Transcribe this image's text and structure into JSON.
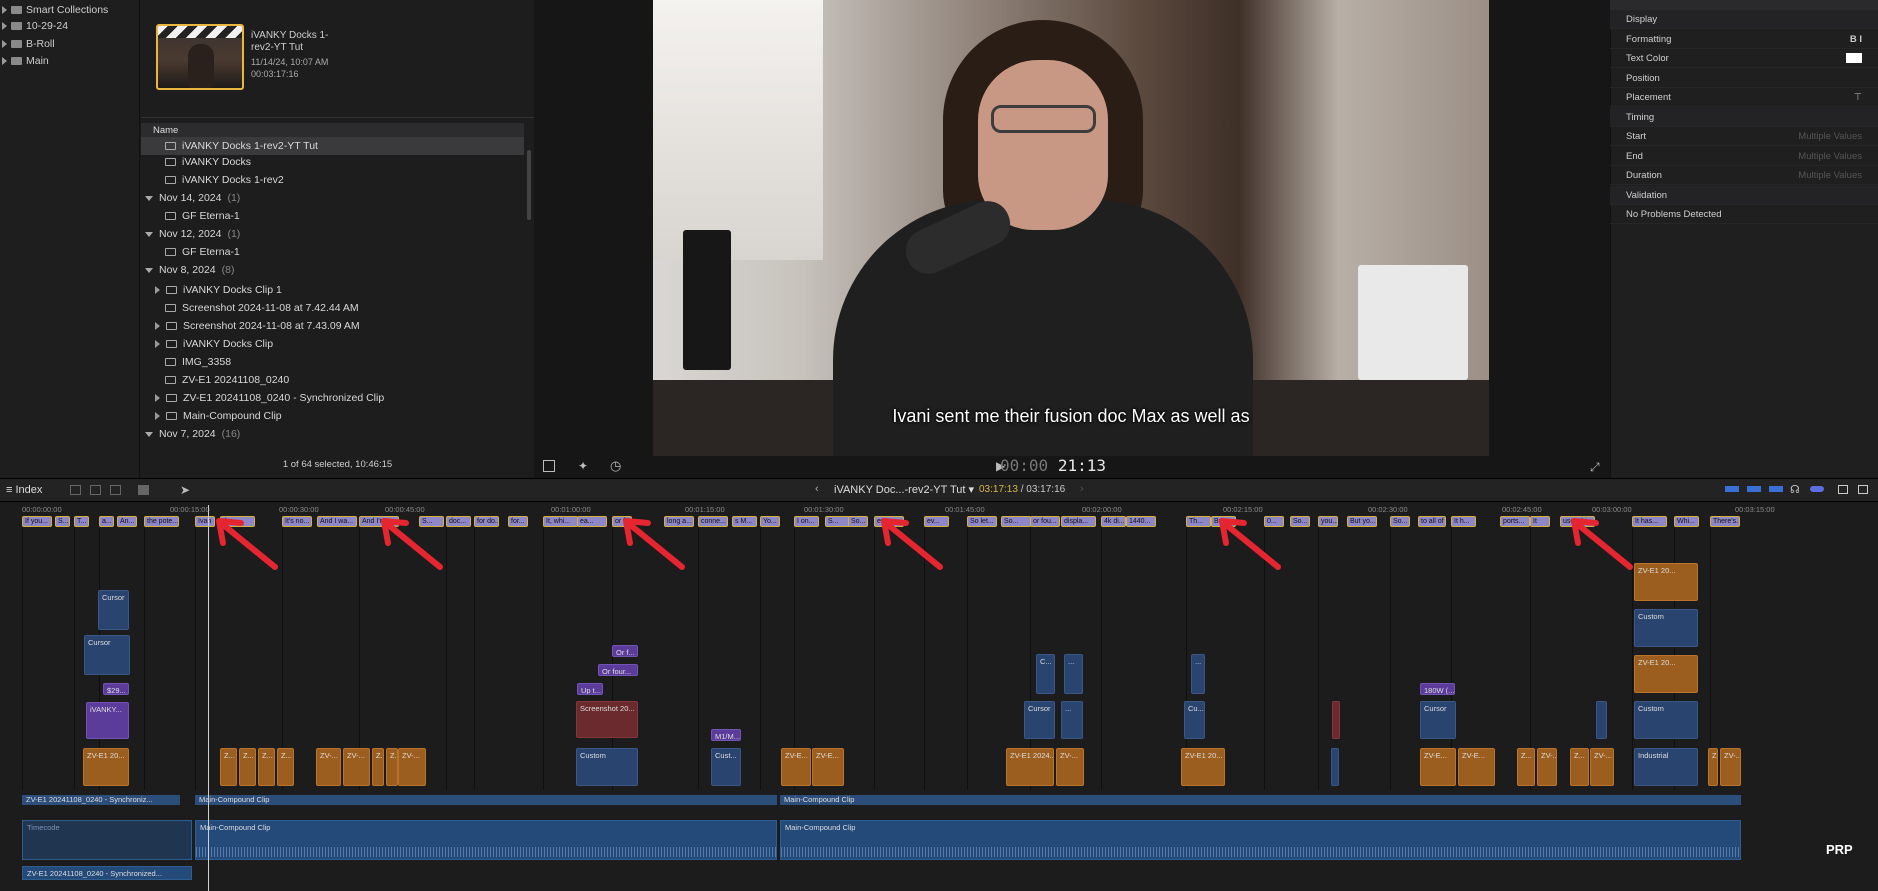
{
  "sidebar": {
    "items": [
      {
        "label": "Smart Collections"
      },
      {
        "label": "10-29-24"
      },
      {
        "label": "B-Roll"
      },
      {
        "label": "Main"
      }
    ]
  },
  "browser": {
    "clip": {
      "title_line1": "iVANKY Docks 1-",
      "title_line2": "rev2-YT Tut",
      "date": "11/14/24, 10:07 AM",
      "duration": "00:03:17:16"
    },
    "column_name": "Name",
    "rows": [
      {
        "label": "iVANKY Docks 1-rev2-YT Tut",
        "kind": "item"
      },
      {
        "label": "iVANKY Docks",
        "kind": "item"
      },
      {
        "label": "iVANKY Docks 1-rev2",
        "kind": "item"
      },
      {
        "label": "Nov 14, 2024",
        "count": "(1)",
        "kind": "group"
      },
      {
        "label": "GF Eterna-1",
        "kind": "item"
      },
      {
        "label": "Nov 12, 2024",
        "count": "(1)",
        "kind": "group"
      },
      {
        "label": "GF Eterna-1",
        "kind": "item"
      },
      {
        "label": "Nov 8, 2024",
        "count": "(8)",
        "kind": "group"
      },
      {
        "label": "iVANKY Docks Clip 1",
        "kind": "item"
      },
      {
        "label": "Screenshot 2024-11-08 at 7.42.44 AM",
        "kind": "item"
      },
      {
        "label": "Screenshot 2024-11-08 at 7.43.09 AM",
        "kind": "item"
      },
      {
        "label": "iVANKY Docks Clip",
        "kind": "item"
      },
      {
        "label": "IMG_3358",
        "kind": "item"
      },
      {
        "label": "ZV-E1 20241108_0240",
        "kind": "item"
      },
      {
        "label": "ZV-E1 20241108_0240 - Synchronized Clip",
        "kind": "item"
      },
      {
        "label": "Main-Compound Clip",
        "kind": "item"
      },
      {
        "label": "Nov 7, 2024",
        "count": "(16)",
        "kind": "group"
      }
    ],
    "status": "1 of 64 selected, 10:46:15"
  },
  "viewer": {
    "subtitle": "Ivani sent me their fusion doc Max as well as",
    "timecode_dim": "00:00",
    "timecode_bright": "21:13"
  },
  "inspector": {
    "rows": [
      {
        "label": "Display",
        "value": ""
      },
      {
        "label": "Formatting",
        "value": "B I"
      },
      {
        "label": "Text Color",
        "value": ""
      },
      {
        "label": "Position",
        "value": ""
      },
      {
        "label": "Placement",
        "value": ""
      },
      {
        "label": "Timing",
        "value": ""
      },
      {
        "label": "Start",
        "value": "Multiple Values"
      },
      {
        "label": "End",
        "value": "Multiple Values"
      },
      {
        "label": "Duration",
        "value": "Multiple Values"
      },
      {
        "label": "Validation",
        "value": ""
      },
      {
        "label": "No Problems Detected",
        "value": ""
      }
    ]
  },
  "timeline": {
    "index_label": "Index",
    "project_title": "iVANKY Doc...-rev2-YT Tut",
    "duration_current": "03:17:13",
    "duration_total": "/ 03:17:16",
    "ruler": [
      "00:00:00:00",
      "00:00:15:00",
      "00:00:30:00",
      "00:00:45:00",
      "00:01:00:00",
      "00:01:15:00",
      "00:01:30:00",
      "00:01:45:00",
      "00:02:00:00",
      "00:02:15:00",
      "00:02:30:00",
      "00:02:45:00",
      "00:03:00:00",
      "00:03:15:00"
    ],
    "captions": [
      "If you...",
      "S...",
      "T...",
      "a...",
      "An...",
      "the pote...",
      "Ivan",
      "the...",
      "It's no...",
      "And I wa...",
      "And I'm",
      "S...",
      "doc...",
      "for do...",
      "for...",
      "It, whi...",
      "ea...",
      "or fus",
      "long a...",
      "conne...",
      "s M...",
      "Yo...",
      "I on...",
      "S...",
      "So...",
      "eve",
      "ev...",
      "So let...",
      "So...",
      "or fou...",
      "displa...",
      "4k di...",
      "1440...",
      "Th...",
      "Bu",
      "0...",
      "So...",
      "you...",
      "But yo...",
      "So...",
      "to all of yo...",
      "It h...",
      "ports...",
      "It",
      "use whi...",
      "It has...",
      "Whi...",
      "There's..."
    ],
    "clips": {
      "cursor": "Cursor",
      "price": "$29...",
      "ivanky": "iVANKY...",
      "zv_short": "ZV-E1 20...",
      "zv_long": "ZV-E1 2024...",
      "orf": "Or f...",
      "orfour": "Or four...",
      "upt": "Up t...",
      "screenshot": "Screenshot 20...",
      "custom": "Custom",
      "cust": "Cust...",
      "m1": "M1/M...",
      "c": "C...",
      "dots": "...",
      "cu": "Cu...",
      "w180": "180W (...",
      "industrial": "Industrial",
      "z": "Z...",
      "zv": "ZV-...",
      "zve": "ZV-E..."
    },
    "storyline_sync": "ZV-E1 20241108_0240 - Synchroniz...",
    "storyline_main": "Main-Compound Clip",
    "audio_main": "Main-Compound Clip",
    "audio_bottom": "ZV-E1 20241108_0240 - Synchronized...",
    "timecode_lane": "Timecode"
  },
  "watermark": "PRP",
  "colors": {
    "accent": "#e9b740",
    "caption": "#8d87c8",
    "annotation_arrow": "#e5252f"
  }
}
